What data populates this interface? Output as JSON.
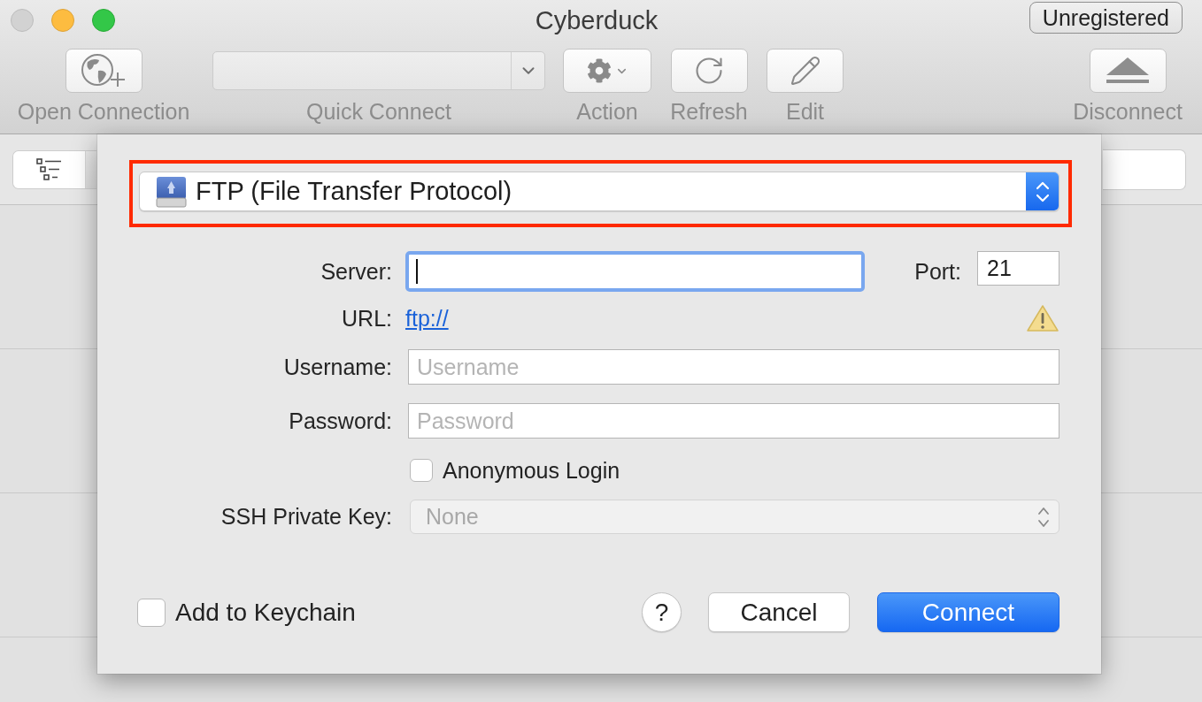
{
  "window": {
    "title": "Cyberduck",
    "registration_button": "Unregistered"
  },
  "toolbar": {
    "open_connection": {
      "label": "Open Connection"
    },
    "quick_connect": {
      "label": "Quick Connect"
    },
    "action": {
      "label": "Action"
    },
    "refresh": {
      "label": "Refresh"
    },
    "edit": {
      "label": "Edit"
    },
    "disconnect": {
      "label": "Disconnect"
    }
  },
  "connection_sheet": {
    "protocol": {
      "value": "FTP (File Transfer Protocol)",
      "highlighted": true
    },
    "server": {
      "label": "Server:",
      "focused": true
    },
    "port": {
      "label": "Port:",
      "value": "21"
    },
    "url": {
      "label": "URL:",
      "link": "ftp://",
      "warning": true
    },
    "username": {
      "label": "Username:",
      "placeholder": "Username"
    },
    "password": {
      "label": "Password:",
      "placeholder": "Password"
    },
    "anonymous_login": {
      "label": "Anonymous Login",
      "checked": false
    },
    "ssh_private_key": {
      "label": "SSH Private Key:",
      "value": "None",
      "disabled": true
    },
    "add_to_keychain": {
      "label": "Add to Keychain",
      "checked": false
    },
    "help_button": "?",
    "buttons": [
      {
        "label": "Cancel",
        "primary": false
      },
      {
        "label": "Connect",
        "primary": true
      }
    ]
  }
}
